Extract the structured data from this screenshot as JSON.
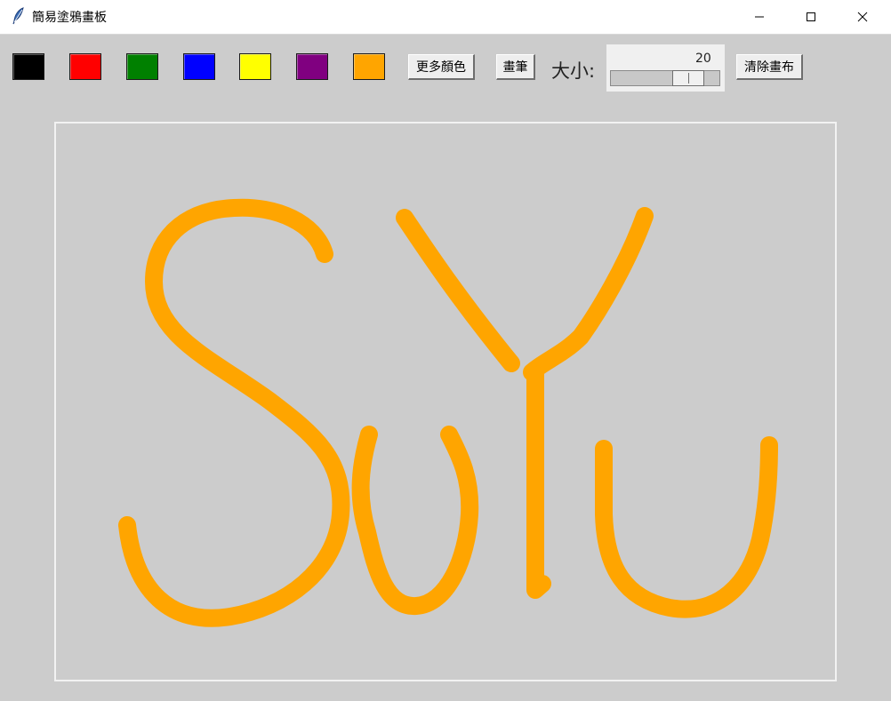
{
  "window": {
    "title": "簡易塗鴉畫板",
    "controls": [
      "minimize",
      "maximize",
      "close"
    ]
  },
  "palette": [
    {
      "name": "black",
      "color": "#000000"
    },
    {
      "name": "red",
      "color": "#ff0000"
    },
    {
      "name": "green",
      "color": "#008000"
    },
    {
      "name": "blue",
      "color": "#0000ff"
    },
    {
      "name": "yellow",
      "color": "#ffff00"
    },
    {
      "name": "purple",
      "color": "#800080"
    },
    {
      "name": "orange",
      "color": "#ffa500"
    }
  ],
  "toolbar": {
    "more_colors_label": "更多顏色",
    "brush_label": "畫筆",
    "size_label": "大小:",
    "size_value": "20",
    "size_min": 1,
    "size_max": 25,
    "clear_label": "清除畫布"
  },
  "canvas": {
    "background": "#cccccc",
    "stroke_color": "#ffa500",
    "stroke_width": 20,
    "drawn_text": "SuYu"
  }
}
